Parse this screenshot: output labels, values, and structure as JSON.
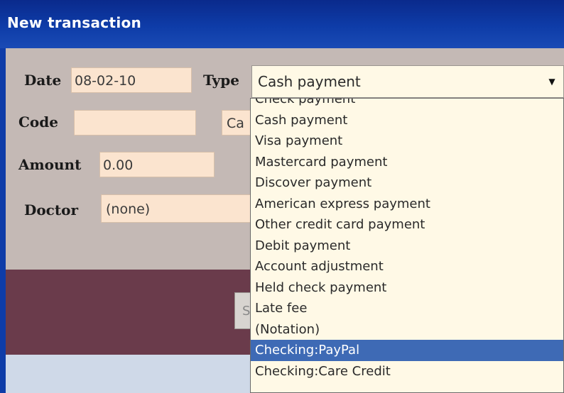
{
  "window": {
    "title": "New transaction"
  },
  "form": {
    "date_label": "Date",
    "date_value": "08-02-10",
    "type_label": "Type",
    "type_value": "Cash payment",
    "code_label": "Code",
    "code_value": "",
    "obscured_field_text": "Ca",
    "amount_label": "Amount",
    "amount_value": "0.00",
    "doctor_label": "Doctor",
    "doctor_value": "(none)",
    "partial_button_text": "S"
  },
  "type_dropdown": {
    "options": [
      "Check payment",
      "Cash payment",
      "Visa payment",
      "Mastercard payment",
      "Discover payment",
      "American express payment",
      "Other credit card payment",
      "Debit payment",
      "Account adjustment",
      "Held check payment",
      "Late fee",
      "(Notation)",
      "Checking:PayPal",
      "Checking:Care Credit"
    ],
    "highlighted_index": 12
  },
  "icons": {
    "dropdown_arrow": "chevron-down-icon"
  }
}
